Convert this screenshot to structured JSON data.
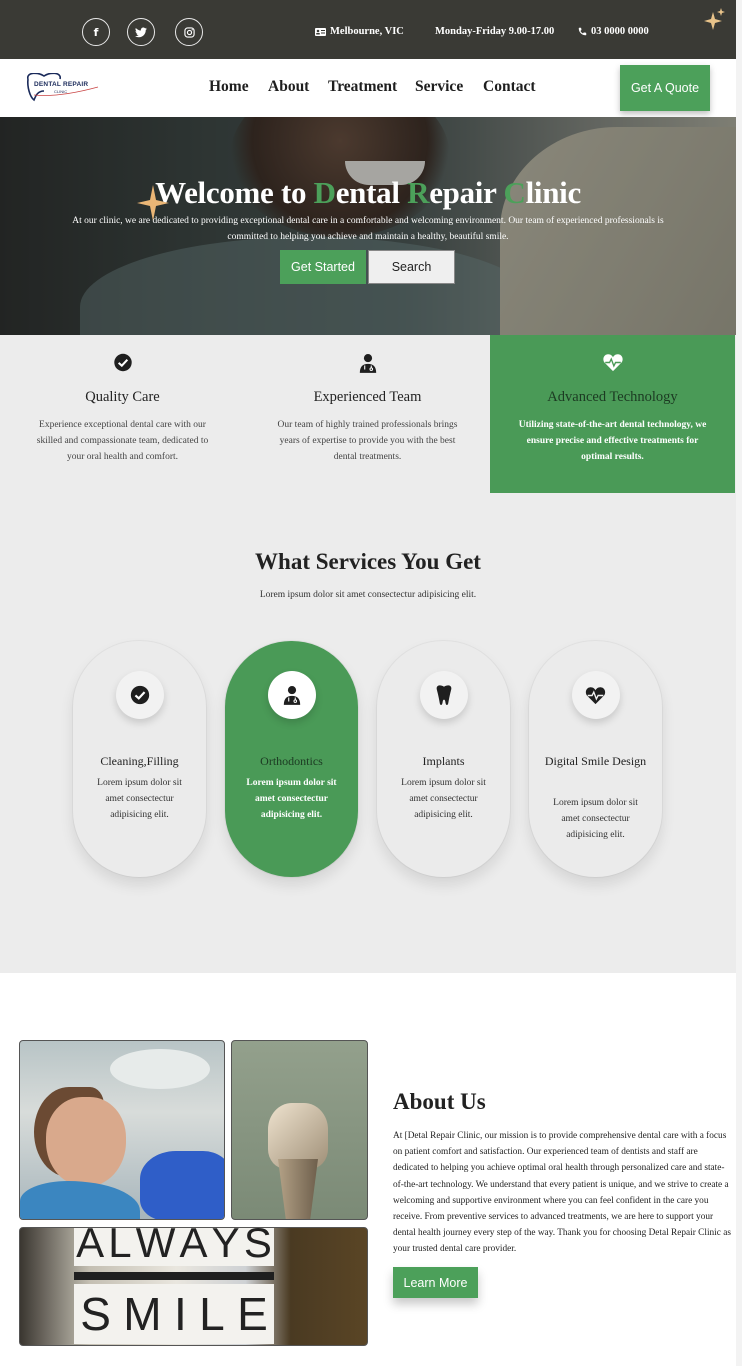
{
  "topbar": {
    "social": [
      {
        "name": "facebook-icon",
        "glyph": "f"
      },
      {
        "name": "twitter-icon",
        "glyph": "t"
      },
      {
        "name": "instagram-icon",
        "glyph": "◎"
      }
    ],
    "location": "Melbourne, VIC",
    "hours": "Monday-Friday 9.00-17.00",
    "phone": "03 0000 0000"
  },
  "nav": {
    "logo_text": "DENTAL REPAIR",
    "logo_sub": "CLINIC",
    "links": [
      "Home",
      "About",
      "Treatment",
      "Service",
      "Contact"
    ],
    "quote_label": "Get A Quote"
  },
  "hero": {
    "title_parts": [
      "Welcome to ",
      "D",
      "ental ",
      "R",
      "epair ",
      "C",
      "linic"
    ],
    "description": "At our clinic, we are dedicated to providing exceptional dental care in a comfortable and welcoming environment. Our team of experienced professionals is committed to helping you achieve and maintain a healthy, beautiful smile.",
    "start_label": "Get Started",
    "search_label": "Search"
  },
  "features": [
    {
      "title": "Quality Care",
      "desc": "Experience exceptional dental care with our skilled and compassionate team, dedicated to your oral health and comfort.",
      "icon": "check-circle-icon"
    },
    {
      "title": "Experienced Team",
      "desc": "Our team of highly trained professionals brings years of expertise to provide you with the best dental treatments.",
      "icon": "doctor-icon"
    },
    {
      "title": "Advanced Technology",
      "desc": "Utilizing state-of-the-art dental technology, we ensure precise and effective treatments for optimal results.",
      "icon": "heartbeat-icon"
    }
  ],
  "services": {
    "title": "What Services You Get",
    "subtitle": "Lorem ipsum dolor sit amet consectectur adipisicing elit.",
    "cards": [
      {
        "title": "Cleaning,Filling",
        "desc": "Lorem ipsum dolor sit amet consectectur adipisicing elit.",
        "icon": "check-circle-icon"
      },
      {
        "title": "Orthodontics",
        "desc": "Lorem ipsum dolor sit amet consectectur adipisicing elit.",
        "icon": "doctor-icon"
      },
      {
        "title": "Implants",
        "desc": "Lorem ipsum dolor sit amet consectectur adipisicing elit.",
        "icon": "tooth-icon"
      },
      {
        "title": "Digital Smile Design",
        "desc": "Lorem ipsum dolor sit amet consectectur adipisicing elit.",
        "icon": "heartbeat-icon"
      }
    ]
  },
  "about": {
    "title": "About Us",
    "text": "At [Detal Repair Clinic, our mission is to provide comprehensive dental care with a focus on patient comfort and satisfaction. Our experienced team of dentists and staff are dedicated to helping you achieve optimal oral health through personalized care and state-of-the-art technology. We understand that every patient is unique, and we strive to create a welcoming and supportive environment where you can feel confident in the care you receive. From preventive services to advanced treatments, we are here to support your dental health journey every step of the way. Thank you for choosing Detal Repair Clinic as your trusted dental care provider.",
    "button_label": "Learn More",
    "lightbox_line1": [
      "A",
      "L",
      "W",
      "A",
      "Y",
      "S"
    ],
    "lightbox_line2": [
      "S",
      "M",
      "I",
      "L",
      "E"
    ]
  },
  "colors": {
    "accent": "#4ca05a",
    "topbar": "#3a3a35",
    "section_bg": "#ececec"
  }
}
